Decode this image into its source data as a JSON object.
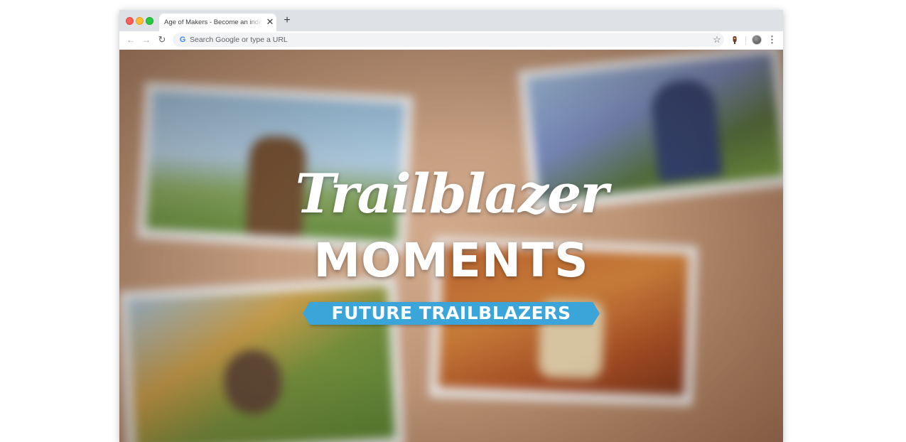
{
  "browser": {
    "tab": {
      "title": "Age of Makers - Become an independent"
    },
    "omnibox": {
      "placeholder": "Search Google or type a URL"
    },
    "icons": {
      "back": "arrow-left",
      "forward": "arrow-right",
      "reload": "reload",
      "close_tab": "close",
      "new_tab": "plus",
      "search_engine": "google-g",
      "bookmark": "star",
      "extension": "extension",
      "profile": "avatar",
      "menu": "more-vertical"
    }
  },
  "video": {
    "title_script": "Trailblazer",
    "title_block": "MOMENTS",
    "ribbon": "FUTURE TRAILBLAZERS"
  },
  "colors": {
    "ribbon": "#3ba4d9",
    "title": "#ffffff"
  }
}
